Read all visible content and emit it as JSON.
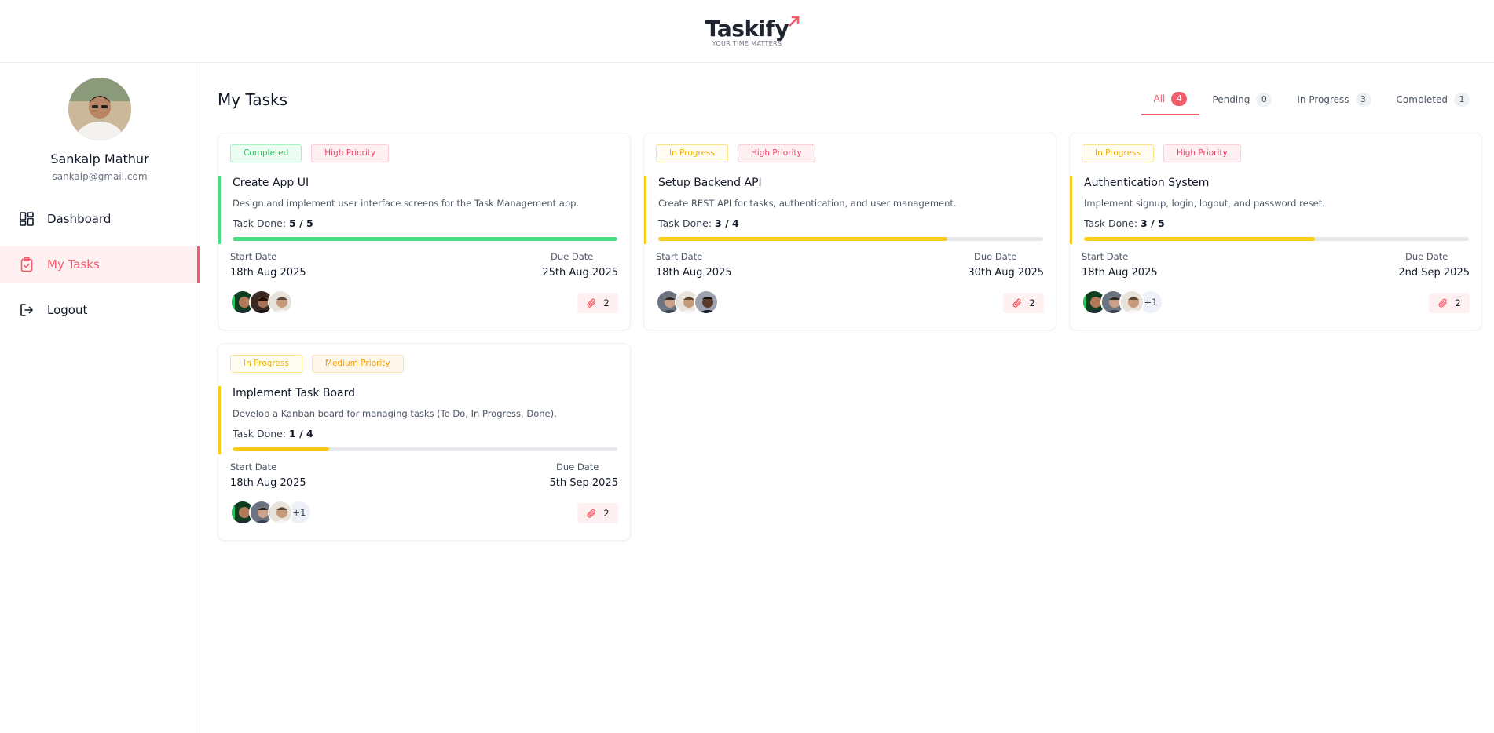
{
  "brand": {
    "name": "Taskify",
    "tagline": "YOUR TIME MATTERS",
    "accent": "#f15b6a"
  },
  "user": {
    "name": "Sankalp Mathur",
    "email": "sankalp@gmail.com"
  },
  "nav": [
    {
      "label": "Dashboard",
      "icon": "dashboard-icon",
      "active": false
    },
    {
      "label": "My Tasks",
      "icon": "clipboard-check-icon",
      "active": true
    },
    {
      "label": "Logout",
      "icon": "logout-icon",
      "active": false
    }
  ],
  "page": {
    "title": "My Tasks"
  },
  "tabs": [
    {
      "label": "All",
      "count": "4",
      "active": true
    },
    {
      "label": "Pending",
      "count": "0",
      "active": false
    },
    {
      "label": "In Progress",
      "count": "3",
      "active": false
    },
    {
      "label": "Completed",
      "count": "1",
      "active": false
    }
  ],
  "labels": {
    "task_done": "Task Done:",
    "start_date": "Start Date",
    "due_date": "Due Date"
  },
  "tasks": [
    {
      "status": "Completed",
      "priority": "High Priority",
      "title": "Create App UI",
      "description": "Design and implement user interface screens for the Task Management app.",
      "done": "5 / 5",
      "progress": 1.0,
      "color": "#4ade80",
      "start": "18th Aug 2025",
      "due": "25th Aug 2025",
      "extra_assignees": "",
      "attachments": "2"
    },
    {
      "status": "In Progress",
      "priority": "High Priority",
      "title": "Setup Backend API",
      "description": "Create REST API for tasks, authentication, and user management.",
      "done": "3 / 4",
      "progress": 0.75,
      "color": "#facc15",
      "start": "18th Aug 2025",
      "due": "30th Aug 2025",
      "extra_assignees": "",
      "attachments": "2"
    },
    {
      "status": "In Progress",
      "priority": "High Priority",
      "title": "Authentication System",
      "description": "Implement signup, login, logout, and password reset.",
      "done": "3 / 5",
      "progress": 0.6,
      "color": "#facc15",
      "start": "18th Aug 2025",
      "due": "2nd Sep 2025",
      "extra_assignees": "+1",
      "attachments": "2"
    },
    {
      "status": "In Progress",
      "priority": "Medium Priority",
      "title": "Implement Task Board",
      "description": "Develop a Kanban board for managing tasks (To Do, In Progress, Done).",
      "done": "1 / 4",
      "progress": 0.25,
      "color": "#facc15",
      "start": "18th Aug 2025",
      "due": "5th Sep 2025",
      "extra_assignees": "+1",
      "attachments": "2"
    }
  ]
}
